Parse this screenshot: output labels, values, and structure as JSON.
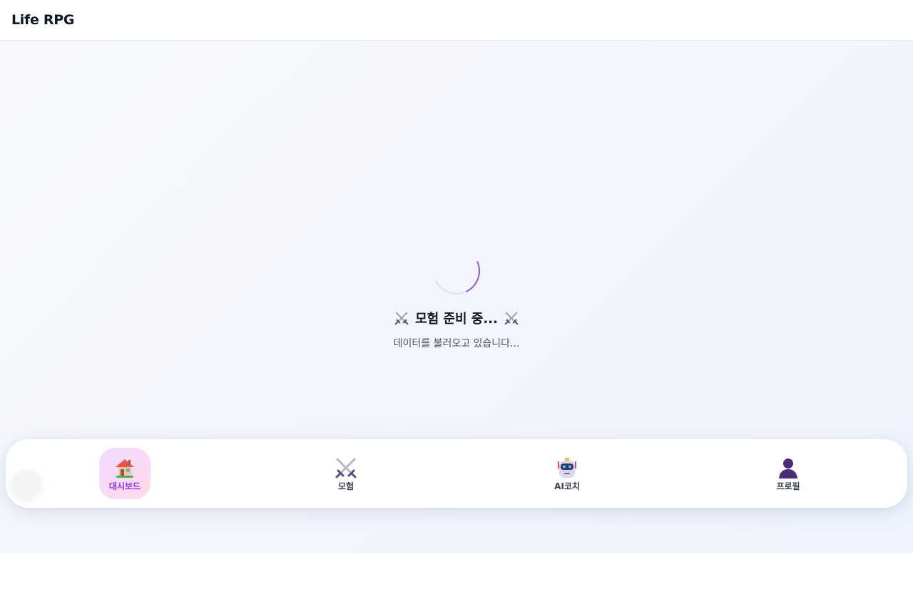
{
  "app": {
    "title": "Life RPG"
  },
  "loading": {
    "title": "모험 준비 중...",
    "subtitle": "데이터를 불러오고 있습니다...",
    "icon_left": "crossed-swords-icon",
    "icon_right": "crossed-swords-icon",
    "spinner_color": "#9b4fe0"
  },
  "nav": {
    "items": [
      {
        "label": "대시보드",
        "icon": "house-icon",
        "active": true
      },
      {
        "label": "모험",
        "icon": "crossed-swords-icon",
        "active": false
      },
      {
        "label": "AI코치",
        "icon": "robot-icon",
        "active": false
      },
      {
        "label": "프로필",
        "icon": "person-silhouette-icon",
        "active": false
      }
    ],
    "active_color": "#9333ea"
  }
}
